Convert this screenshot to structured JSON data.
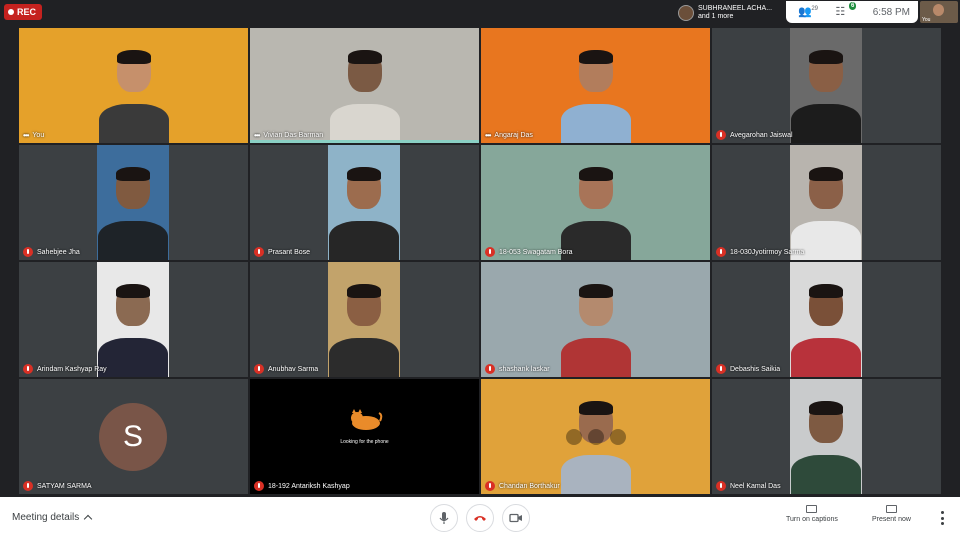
{
  "recording": {
    "label": "REC"
  },
  "presenter": {
    "name": "SUBHRANEEL ACHA...",
    "more": "and 1 more"
  },
  "topbar": {
    "participants_count": "29",
    "chat_badge": "6",
    "time": "6:58 PM",
    "self_label": "You"
  },
  "participants": [
    {
      "name": "You",
      "indicator": "dots",
      "bg": "#e5a12a",
      "skin": "#c6906b",
      "shirt": "#3a3a3a"
    },
    {
      "name": "Vivian Das Barman",
      "indicator": "dots",
      "bg": "#b9b7b0",
      "skin": "#7b5a44",
      "shirt": "#d9d6cf",
      "active": true
    },
    {
      "name": "Angaraj Das",
      "indicator": "dots",
      "bg": "#e8761f",
      "skin": "#b27d5c",
      "shirt": "#8fb0d1"
    },
    {
      "name": "Avegarohan Jaiswal",
      "indicator": "mic-off",
      "bg": "#6a6a6a",
      "skin": "#8a5f45",
      "shirt": "#1c1c1c"
    },
    {
      "name": "Sahebjee Jha",
      "indicator": "mic-off",
      "bg": "#3d6d9c",
      "skin": "#805a40",
      "shirt": "#1e2328"
    },
    {
      "name": "Prasant Bose",
      "indicator": "mic-off",
      "bg": "#8eb3c8",
      "skin": "#9c6c4e",
      "shirt": "#262626"
    },
    {
      "name": "18-053 Swagatam Bora",
      "indicator": "mic-off",
      "bg": "#86a79a",
      "skin": "#a87458",
      "shirt": "#2a2a2a"
    },
    {
      "name": "18-030Jyotirmoy Sarma",
      "indicator": "mic-off",
      "bg": "#b8b4ae",
      "skin": "#8b6048",
      "shirt": "#e8e8e8"
    },
    {
      "name": "Arindam Kashyap Ray",
      "indicator": "mic-off",
      "bg": "#e8e8e8",
      "skin": "#8b6a52",
      "shirt": "#232536"
    },
    {
      "name": "Anubhav Sarma",
      "indicator": "mic-off",
      "bg": "#c2a36b",
      "skin": "#8b5f43",
      "shirt": "#2c2c2c"
    },
    {
      "name": "shashank laskar",
      "indicator": "mic-off",
      "bg": "#9aa8ad",
      "skin": "#b48a6e",
      "shirt": "#b03535"
    },
    {
      "name": "Debashis Saikia",
      "indicator": "mic-off",
      "bg": "#d9d9d9",
      "skin": "#7a5038",
      "shirt": "#b8323b"
    },
    {
      "name": "SATYAM SARMA",
      "indicator": "mic-off",
      "avatar_letter": "S",
      "avatar_color": "#795548"
    },
    {
      "name": "18-192 Antariksh Kashyap",
      "indicator": "mic-off",
      "loading_text": "Looking for the phone"
    },
    {
      "name": "Chandan Borthakur",
      "indicator": "mic-off",
      "bg": "#e0a23a",
      "skin": "#9a6b4e",
      "shirt": "#a9b3bf"
    },
    {
      "name": "Neel Kamal Das",
      "indicator": "mic-off",
      "bg": "#c9cbcc",
      "skin": "#7e5a42",
      "shirt": "#2e4a3a"
    }
  ],
  "bottombar": {
    "meeting_details": "Meeting details",
    "captions_label": "Turn on captions",
    "present_label": "Present now"
  },
  "colors": {
    "accent_red": "#d93025",
    "rec_red": "#c5221f",
    "active_speaker": "#8ad0c4"
  }
}
